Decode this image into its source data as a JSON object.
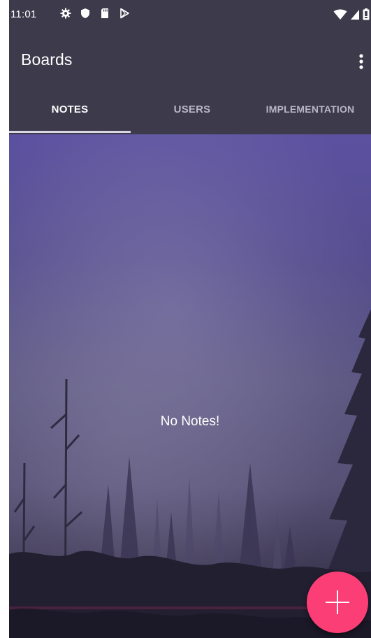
{
  "status_bar": {
    "time": "11:01",
    "left_icons": [
      "settings-icon",
      "shield-icon",
      "sd-card-icon",
      "play-store-icon"
    ],
    "right_icons": [
      "wifi-icon",
      "signal-icon",
      "battery-icon"
    ]
  },
  "app_bar": {
    "title": "Boards",
    "menu_icon": "more-vert-icon"
  },
  "tabs": [
    {
      "label": "NOTES",
      "selected": true
    },
    {
      "label": "USERS",
      "selected": false
    },
    {
      "label": "IMPLEMENTATION",
      "selected": false
    }
  ],
  "content": {
    "empty_message": "No Notes!"
  },
  "fab": {
    "icon": "plus-icon"
  },
  "colors": {
    "app_bar": "#3d3a4b",
    "accent": "#fb3f76",
    "tab_indicator": "#d9d7e3"
  }
}
